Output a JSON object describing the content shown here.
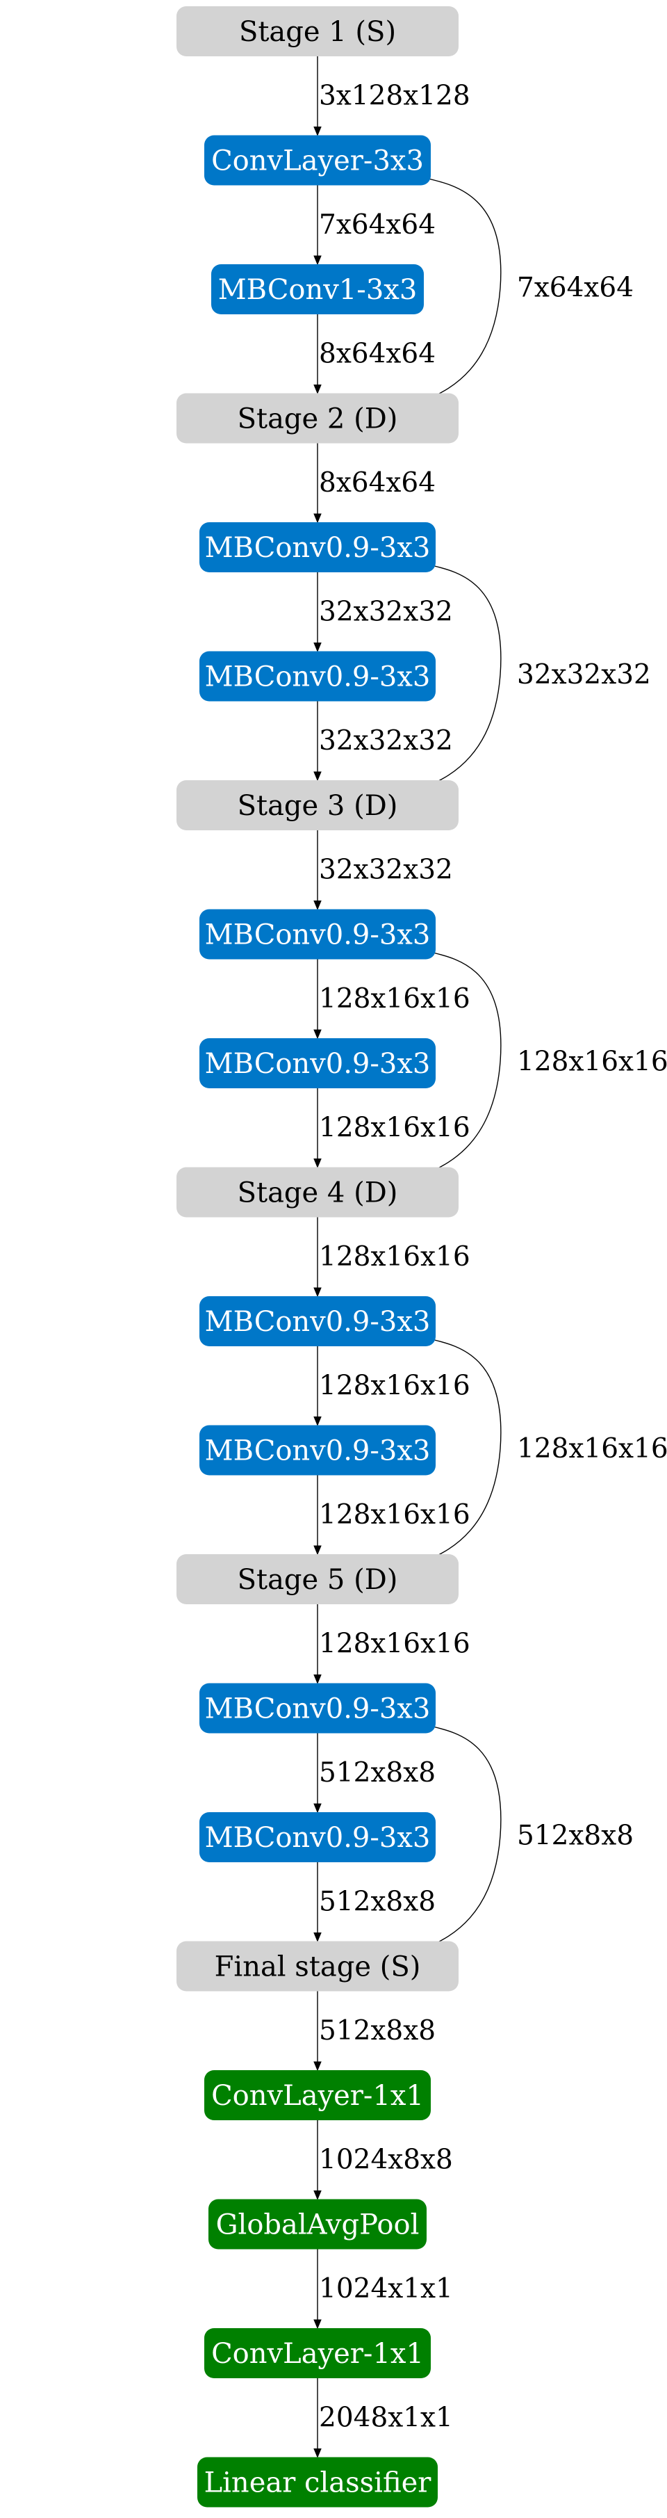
{
  "colors": {
    "stage_fill": "#d3d3d3",
    "stage_text": "#000000",
    "block_blue": "#0077c8",
    "block_green": "#008000",
    "block_text": "#ffffff"
  },
  "nodes": [
    {
      "id": "stage1",
      "label": "Stage 1 (S)",
      "kind": "stage"
    },
    {
      "id": "conv3x3",
      "label": "ConvLayer-3x3",
      "kind": "blue"
    },
    {
      "id": "mbconv1",
      "label": "MBConv1-3x3",
      "kind": "blue"
    },
    {
      "id": "stage2",
      "label": "Stage 2 (D)",
      "kind": "stage"
    },
    {
      "id": "s2b1",
      "label": "MBConv0.9-3x3",
      "kind": "blue"
    },
    {
      "id": "s2b2",
      "label": "MBConv0.9-3x3",
      "kind": "blue"
    },
    {
      "id": "stage3",
      "label": "Stage 3 (D)",
      "kind": "stage"
    },
    {
      "id": "s3b1",
      "label": "MBConv0.9-3x3",
      "kind": "blue"
    },
    {
      "id": "s3b2",
      "label": "MBConv0.9-3x3",
      "kind": "blue"
    },
    {
      "id": "stage4",
      "label": "Stage 4 (D)",
      "kind": "stage"
    },
    {
      "id": "s4b1",
      "label": "MBConv0.9-3x3",
      "kind": "blue"
    },
    {
      "id": "s4b2",
      "label": "MBConv0.9-3x3",
      "kind": "blue"
    },
    {
      "id": "stage5",
      "label": "Stage 5 (D)",
      "kind": "stage"
    },
    {
      "id": "s5b1",
      "label": "MBConv0.9-3x3",
      "kind": "blue"
    },
    {
      "id": "s5b2",
      "label": "MBConv0.9-3x3",
      "kind": "blue"
    },
    {
      "id": "final",
      "label": "Final stage (S)",
      "kind": "stage"
    },
    {
      "id": "conv1x1a",
      "label": "ConvLayer-1x1",
      "kind": "green"
    },
    {
      "id": "gap",
      "label": "GlobalAvgPool",
      "kind": "green"
    },
    {
      "id": "conv1x1b",
      "label": "ConvLayer-1x1",
      "kind": "green"
    },
    {
      "id": "linear",
      "label": "Linear classifier",
      "kind": "green"
    }
  ],
  "edges": [
    {
      "from": "stage1",
      "to": "conv3x3",
      "label": "3x128x128"
    },
    {
      "from": "conv3x3",
      "to": "mbconv1",
      "label": "7x64x64"
    },
    {
      "from": "mbconv1",
      "to": "stage2",
      "label": "8x64x64"
    },
    {
      "from": "conv3x3",
      "to": "stage2",
      "label": "7x64x64",
      "skip": true
    },
    {
      "from": "stage2",
      "to": "s2b1",
      "label": "8x64x64"
    },
    {
      "from": "s2b1",
      "to": "s2b2",
      "label": "32x32x32"
    },
    {
      "from": "s2b2",
      "to": "stage3",
      "label": "32x32x32"
    },
    {
      "from": "s2b1",
      "to": "stage3",
      "label": "32x32x32",
      "skip": true
    },
    {
      "from": "stage3",
      "to": "s3b1",
      "label": "32x32x32"
    },
    {
      "from": "s3b1",
      "to": "s3b2",
      "label": "128x16x16"
    },
    {
      "from": "s3b2",
      "to": "stage4",
      "label": "128x16x16"
    },
    {
      "from": "s3b1",
      "to": "stage4",
      "label": "128x16x16",
      "skip": true
    },
    {
      "from": "stage4",
      "to": "s4b1",
      "label": "128x16x16"
    },
    {
      "from": "s4b1",
      "to": "s4b2",
      "label": "128x16x16"
    },
    {
      "from": "s4b2",
      "to": "stage5",
      "label": "128x16x16"
    },
    {
      "from": "s4b1",
      "to": "stage5",
      "label": "128x16x16",
      "skip": true
    },
    {
      "from": "stage5",
      "to": "s5b1",
      "label": "128x16x16"
    },
    {
      "from": "s5b1",
      "to": "s5b2",
      "label": "512x8x8"
    },
    {
      "from": "s5b2",
      "to": "final",
      "label": "512x8x8"
    },
    {
      "from": "s5b1",
      "to": "final",
      "label": "512x8x8",
      "skip": true
    },
    {
      "from": "final",
      "to": "conv1x1a",
      "label": "512x8x8"
    },
    {
      "from": "conv1x1a",
      "to": "gap",
      "label": "1024x8x8"
    },
    {
      "from": "gap",
      "to": "conv1x1b",
      "label": "1024x1x1"
    },
    {
      "from": "conv1x1b",
      "to": "linear",
      "label": "2048x1x1"
    }
  ]
}
